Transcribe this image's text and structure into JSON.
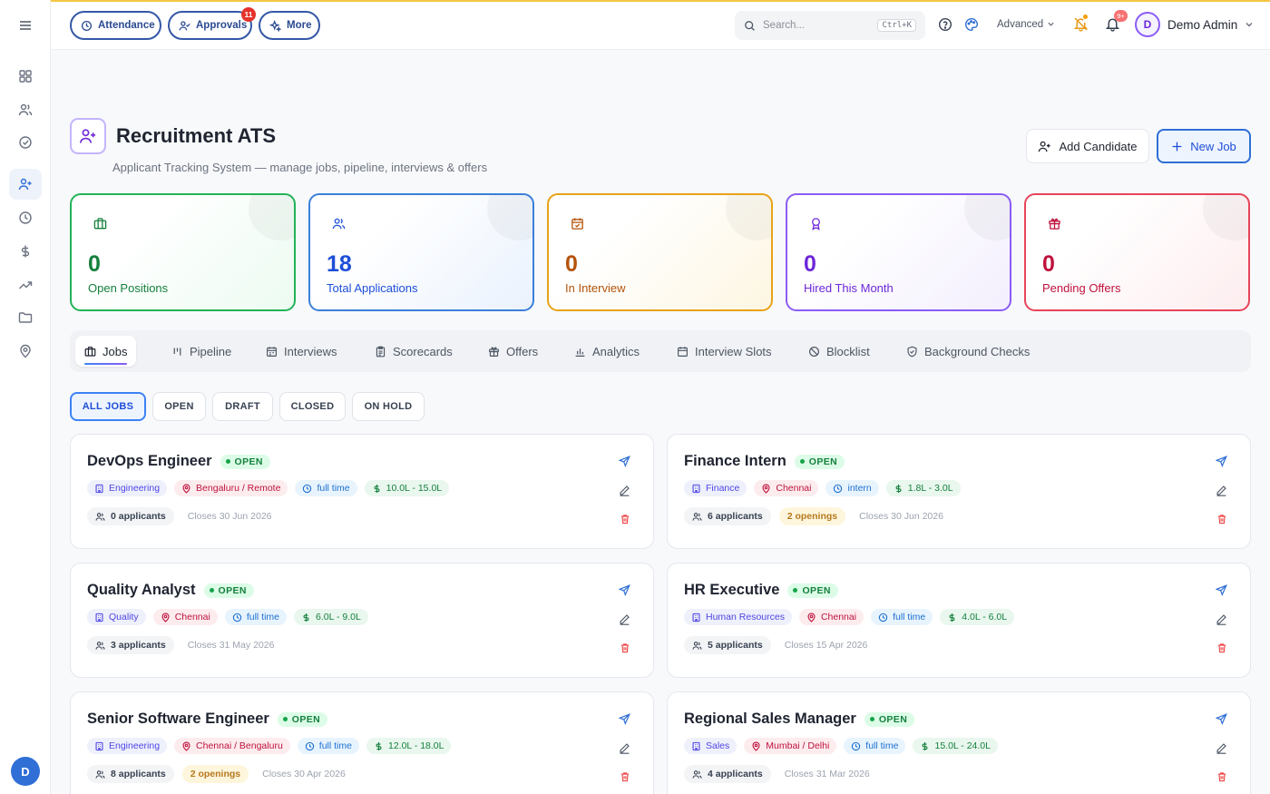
{
  "topbar": {
    "attendance_label": "Attendance",
    "approvals_label": "Approvals",
    "approvals_badge": "11",
    "more_label": "More",
    "search_placeholder": "Search...",
    "search_shortcut": "Ctrl+K",
    "mode_label": "Advanced",
    "notifications_badge": "9+",
    "user_initial": "D",
    "user_name": "Demo Admin"
  },
  "sidebar": {
    "items": [
      "dashboard-icon",
      "users-icon",
      "check-circle-icon",
      "user-plus-icon",
      "clock-icon",
      "dollar-icon",
      "trending-icon",
      "folder-icon",
      "map-pin-icon"
    ],
    "active": "user-plus-icon",
    "avatar_initial": "D"
  },
  "header": {
    "title": "Recruitment ATS",
    "subtitle": "Applicant Tracking System — manage jobs, pipeline, interviews & offers",
    "add_candidate_label": "Add Candidate",
    "new_job_label": "New Job"
  },
  "stats": [
    {
      "value": "0",
      "label": "Open Positions",
      "color": "#22b357"
    },
    {
      "value": "18",
      "label": "Total Applications",
      "color": "#3b7fd9"
    },
    {
      "value": "0",
      "label": "In Interview",
      "color": "#e8a317"
    },
    {
      "value": "0",
      "label": "Hired This Month",
      "color": "#8b5cf6"
    },
    {
      "value": "0",
      "label": "Pending Offers",
      "color": "#e8445a"
    }
  ],
  "tabs": [
    "Jobs",
    "Pipeline",
    "Interviews",
    "Scorecards",
    "Offers",
    "Analytics",
    "Interview Slots",
    "Blocklist",
    "Background Checks"
  ],
  "filters": [
    "ALL JOBS",
    "OPEN",
    "DRAFT",
    "CLOSED",
    "ON HOLD"
  ],
  "jobs": [
    {
      "title": "DevOps Engineer",
      "status": "OPEN",
      "dept": "Engineering",
      "location": "Bengaluru / Remote",
      "type": "full time",
      "salary": "10.0L - 15.0L",
      "applicants": "0 applicants",
      "openings": "",
      "closes": "Closes 30 Jun 2026"
    },
    {
      "title": "Finance Intern",
      "status": "OPEN",
      "dept": "Finance",
      "location": "Chennai",
      "type": "intern",
      "salary": "1.8L - 3.0L",
      "applicants": "6 applicants",
      "openings": "2 openings",
      "closes": "Closes 30 Jun 2026"
    },
    {
      "title": "Quality Analyst",
      "status": "OPEN",
      "dept": "Quality",
      "location": "Chennai",
      "type": "full time",
      "salary": "6.0L - 9.0L",
      "applicants": "3 applicants",
      "openings": "",
      "closes": "Closes 31 May 2026"
    },
    {
      "title": "HR Executive",
      "status": "OPEN",
      "dept": "Human Resources",
      "location": "Chennai",
      "type": "full time",
      "salary": "4.0L - 6.0L",
      "applicants": "5 applicants",
      "openings": "",
      "closes": "Closes 15 Apr 2026"
    },
    {
      "title": "Senior Software Engineer",
      "status": "OPEN",
      "dept": "Engineering",
      "location": "Chennai / Bengaluru",
      "type": "full time",
      "salary": "12.0L - 18.0L",
      "applicants": "8 applicants",
      "openings": "2 openings",
      "closes": "Closes 30 Apr 2026"
    },
    {
      "title": "Regional Sales Manager",
      "status": "OPEN",
      "dept": "Sales",
      "location": "Mumbai / Delhi",
      "type": "full time",
      "salary": "15.0L - 24.0L",
      "applicants": "4 applicants",
      "openings": "",
      "closes": "Closes 31 Mar 2026"
    }
  ]
}
